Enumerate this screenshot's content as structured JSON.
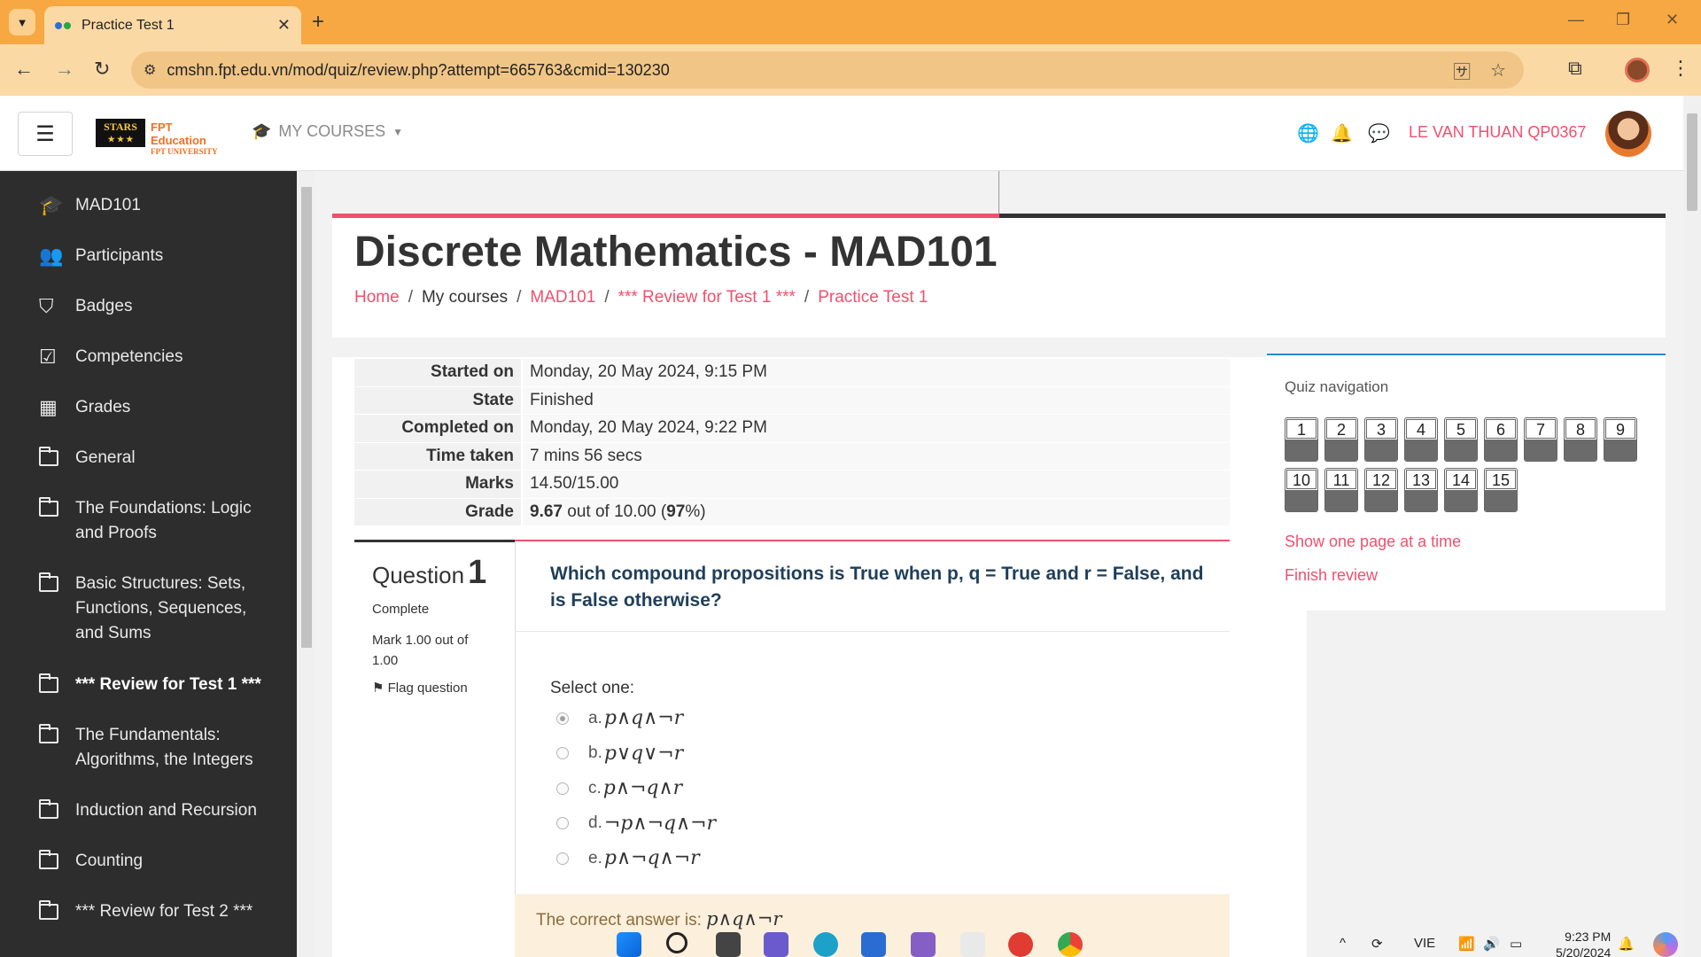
{
  "browser": {
    "tab_title": "Practice Test 1",
    "tab_close": "✕",
    "new_tab": "+",
    "url": "cmshn.fpt.edu.vn/mod/quiz/review.php?attempt=665763&cmid=130230",
    "window_minimize": "—",
    "window_restore": "❐",
    "window_close": "✕"
  },
  "header": {
    "logo_stars": "STARS",
    "logo_stars_sub": "★ ★ ★",
    "logo_fpt": "FPT Education",
    "logo_fpt_uni": "FPT UNIVERSITY",
    "my_courses": "MY COURSES",
    "user_name": "LE VAN THUAN QP0367"
  },
  "sidebar": {
    "items": [
      {
        "label": "MAD101",
        "icon": "graduation-cap-icon"
      },
      {
        "label": "Participants",
        "icon": "users-icon"
      },
      {
        "label": "Badges",
        "icon": "shield-icon"
      },
      {
        "label": "Competencies",
        "icon": "checkbox-icon"
      },
      {
        "label": "Grades",
        "icon": "table-icon"
      },
      {
        "label": "General",
        "icon": "folder-icon"
      },
      {
        "label": "The Foundations: Logic and Proofs",
        "icon": "folder-icon"
      },
      {
        "label": "Basic Structures: Sets, Functions, Sequences, and Sums",
        "icon": "folder-icon"
      },
      {
        "label": "*** Review for Test 1 ***",
        "icon": "folder-icon",
        "active": true
      },
      {
        "label": "The Fundamentals: Algorithms, the Integers",
        "icon": "folder-icon"
      },
      {
        "label": "Induction and Recursion",
        "icon": "folder-icon"
      },
      {
        "label": "Counting",
        "icon": "folder-icon"
      },
      {
        "label": "*** Review for Test 2 ***",
        "icon": "folder-icon"
      }
    ]
  },
  "page": {
    "title": "Discrete Mathematics - MAD101",
    "breadcrumb": [
      {
        "label": "Home",
        "link": true
      },
      {
        "label": "My courses",
        "link": false
      },
      {
        "label": "MAD101",
        "link": true
      },
      {
        "label": "*** Review for Test 1 ***",
        "link": true
      },
      {
        "label": "Practice Test 1",
        "link": true
      }
    ],
    "breadcrumb_sep": "/"
  },
  "summary": {
    "rows": [
      {
        "label": "Started on",
        "value": "Monday, 20 May 2024, 9:15 PM"
      },
      {
        "label": "State",
        "value": "Finished"
      },
      {
        "label": "Completed on",
        "value": "Monday, 20 May 2024, 9:22 PM"
      },
      {
        "label": "Time taken",
        "value": "7 mins 56 secs"
      },
      {
        "label": "Marks",
        "value": "14.50/15.00"
      }
    ],
    "grade_label": "Grade",
    "grade_value": "9.67",
    "grade_outof": " out of 10.00 (",
    "grade_percent": "97",
    "grade_end": "%)"
  },
  "question": {
    "label": "Question",
    "number": "1",
    "state": "Complete",
    "mark": "Mark 1.00 out of 1.00",
    "flag": "Flag question",
    "text": "Which compound propositions is True when p, q = True and r = False, and is False otherwise?",
    "select_one": "Select one:",
    "answers": [
      {
        "letter": "a.",
        "math": "p∧q∧¬r",
        "checked": true
      },
      {
        "letter": "b.",
        "math": "p∨q∨¬r",
        "checked": false
      },
      {
        "letter": "c.",
        "math": "p∧¬q∧r",
        "checked": false
      },
      {
        "letter": "d.",
        "math": "¬p∧¬q∧¬r",
        "checked": false
      },
      {
        "letter": "e.",
        "math": "p∧¬q∧¬r",
        "checked": false
      }
    ],
    "correct_label": "The correct answer is: ",
    "correct_math": "p∧q∧¬r"
  },
  "quiz_nav": {
    "title": "Quiz navigation",
    "buttons": [
      "1",
      "2",
      "3",
      "4",
      "5",
      "6",
      "7",
      "8",
      "9",
      "10",
      "11",
      "12",
      "13",
      "14",
      "15"
    ],
    "show_one_page": "Show one page at a time",
    "finish_review": "Finish review"
  },
  "taskbar": {
    "language": "VIE",
    "time": "9:23 PM",
    "date": "5/20/2024"
  },
  "colors": {
    "accent": "#f0506e",
    "sidebar_bg": "#2d2d2d",
    "chrome_tab": "#f7a842",
    "nav_border": "#2e88c9"
  }
}
